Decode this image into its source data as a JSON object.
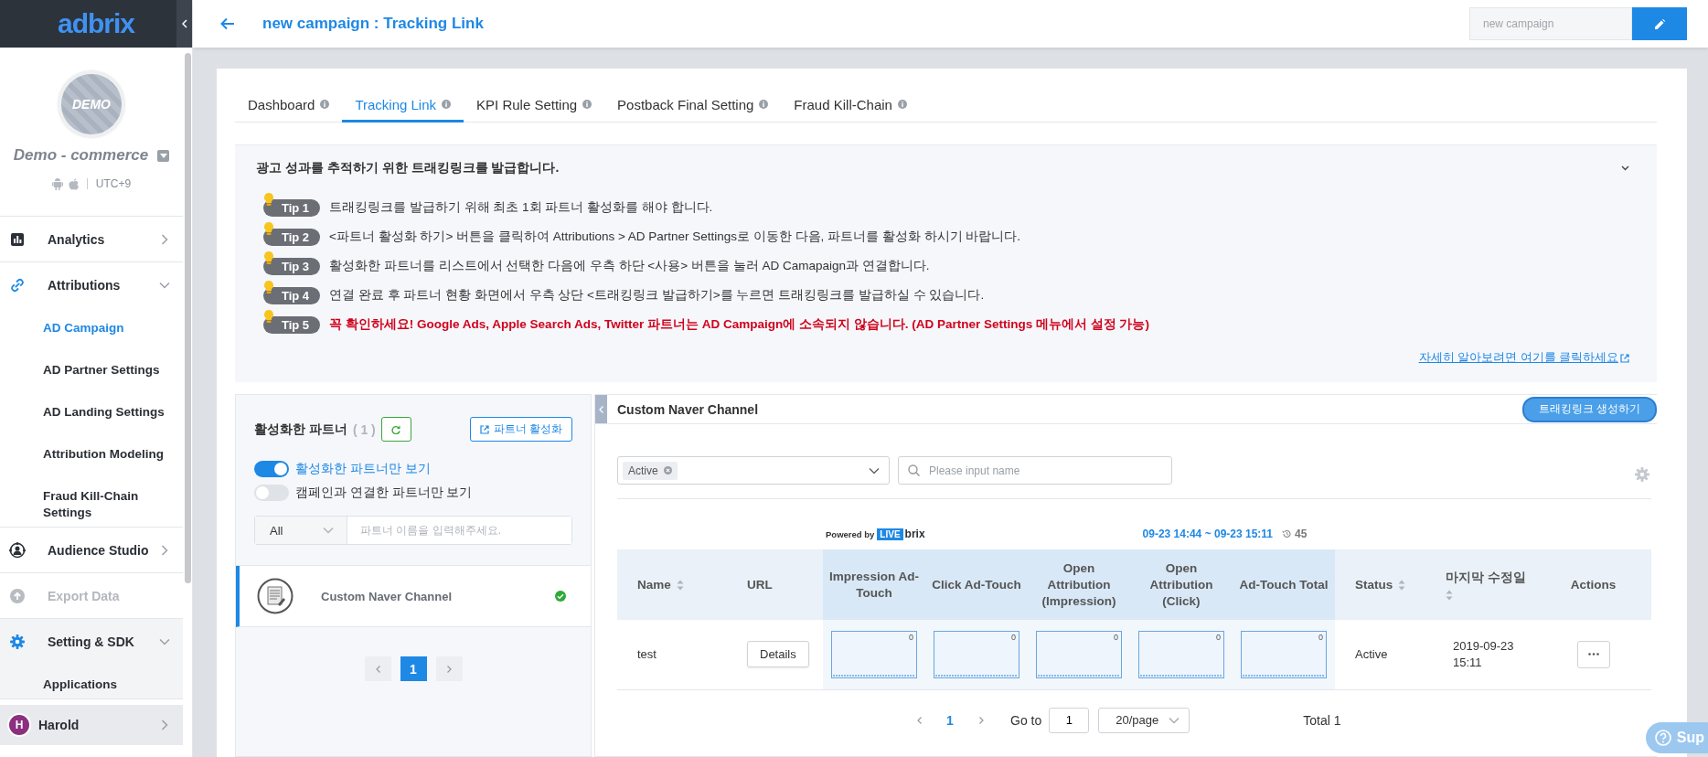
{
  "sidebar": {
    "logo": "adbrix",
    "account": {
      "avatar_label": "DEMO",
      "name": "Demo - commerce",
      "timezone": "UTC+9"
    },
    "menu": [
      {
        "label": "Analytics",
        "expanded": false,
        "disabled": false,
        "hovered": false
      },
      {
        "label": "Attributions",
        "expanded": true,
        "disabled": false,
        "hovered": false,
        "children": [
          {
            "label": "AD Campaign",
            "selected": true
          },
          {
            "label": "AD Partner Settings",
            "selected": false
          },
          {
            "label": "AD Landing Settings",
            "selected": false
          },
          {
            "label": "Attribution Modeling",
            "selected": false
          },
          {
            "label": "Fraud Kill-Chain Settings",
            "selected": false
          }
        ]
      },
      {
        "label": "Audience Studio",
        "expanded": false,
        "disabled": false,
        "hovered": false
      },
      {
        "label": "Export Data",
        "expanded": false,
        "disabled": true,
        "hovered": false
      },
      {
        "label": "Setting & SDK",
        "expanded": true,
        "disabled": false,
        "hovered": true,
        "children": [
          {
            "label": "Applications",
            "selected": false
          }
        ]
      }
    ],
    "user": {
      "initial": "H",
      "name": "Harold"
    }
  },
  "header": {
    "title": "new campaign : Tracking Link",
    "campaign_field": {
      "placeholder": "new campaign"
    }
  },
  "tabs": [
    {
      "label": "Dashboard",
      "selected": false
    },
    {
      "label": "Tracking Link",
      "selected": true
    },
    {
      "label": "KPI Rule Setting",
      "selected": false
    },
    {
      "label": "Postback Final Setting",
      "selected": false
    },
    {
      "label": "Fraud Kill-Chain",
      "selected": false
    }
  ],
  "guide": {
    "title": "광고 성과를 추적하기 위한 트래킹링크를 발급합니다.",
    "expanded": true,
    "tips": [
      {
        "badge": "Tip 1",
        "kind": "note",
        "text": "트래킹링크를 발급하기 위해 최초 1회 파트너 활성화를 해야 합니다."
      },
      {
        "badge": "Tip 2",
        "kind": "note",
        "text": "<파트너 활성화 하기> 버튼을 클릭하여 Attributions > AD Partner Settings로 이동한 다음, 파트너를 활성화 하시기 바랍니다."
      },
      {
        "badge": "Tip 3",
        "kind": "note",
        "text": "활성화한 파트너를 리스트에서 선택한 다음에 우측 하단 <사용> 버튼을 눌러 AD Camapaign과 연결합니다."
      },
      {
        "badge": "Tip 4",
        "kind": "note",
        "text": "연결 완료 후 파트너 현황 화면에서 우측 상단 <트래킹링크 발급하기>를 누르면 트래킹링크를 발급하실 수 있습니다."
      },
      {
        "badge": "Tip 5",
        "kind": "warning",
        "text": "꼭 확인하세요! Google Ads, Apple Search Ads, Twitter 파트너는 AD Campaign에 소속되지 않습니다. (AD Partner Settings 메뉴에서 설정 가능)"
      }
    ],
    "link": "자세히 알아보려면 여기를 클릭하세요"
  },
  "partners": {
    "title": "활성화한 파트너",
    "count": "( 1 )",
    "activate_button": "파트너 활성화",
    "toggles": [
      {
        "label": "활성화한 파트너만 보기",
        "on": true
      },
      {
        "label": "캠페인과 연결한 파트너만 보기",
        "on": false
      }
    ],
    "filter": {
      "value": "All",
      "placeholder": "파트너 이름을 입력해주세요."
    },
    "items": [
      {
        "name": "Custom Naver Channel",
        "selected": true,
        "active": true
      }
    ],
    "pages": [
      {
        "label": "1",
        "selected": true
      }
    ]
  },
  "detail": {
    "title": "Custom Naver Channel",
    "create_button": "트래킹링크 생성하기",
    "status_filter": {
      "tags": [
        "Active"
      ]
    },
    "search": {
      "placeholder": "Please input name"
    },
    "powered_by": "Powered by",
    "live_badge": "LIVE",
    "brand": "brix",
    "date_range": "09-23 14:44 ~ 09-23 15:11",
    "refresh_count": "45",
    "table": {
      "columns": [
        {
          "label": "Name",
          "kind": "plain",
          "sortable": true
        },
        {
          "label": "URL",
          "kind": "plain",
          "sortable": false
        },
        {
          "label": "Impression Ad-Touch",
          "kind": "metric",
          "sortable": false
        },
        {
          "label": "Click Ad-Touch",
          "kind": "metric",
          "sortable": false
        },
        {
          "label": "Open Attribution (Impression)",
          "kind": "metric",
          "sortable": false
        },
        {
          "label": "Open Attribution (Click)",
          "kind": "metric",
          "sortable": false
        },
        {
          "label": "Ad-Touch Total",
          "kind": "metric",
          "sortable": false
        },
        {
          "label": "Status",
          "kind": "plain",
          "sortable": true
        },
        {
          "label": "마지막 수정일",
          "kind": "plain",
          "sortable": true
        },
        {
          "label": "Actions",
          "kind": "plain",
          "sortable": false
        }
      ],
      "rows": [
        {
          "name": "test",
          "url_button": "Details",
          "metrics": [
            "0",
            "0",
            "0",
            "0",
            "0"
          ],
          "status": "Active",
          "modified": "2019-09-23 15:11"
        }
      ]
    },
    "pagination": {
      "pages": [
        {
          "label": "1",
          "selected": true
        }
      ],
      "goto_label": "Go to",
      "goto_value": "1",
      "page_size": "20/page",
      "total": "Total 1"
    }
  },
  "help_button": {
    "label": "Sup"
  }
}
